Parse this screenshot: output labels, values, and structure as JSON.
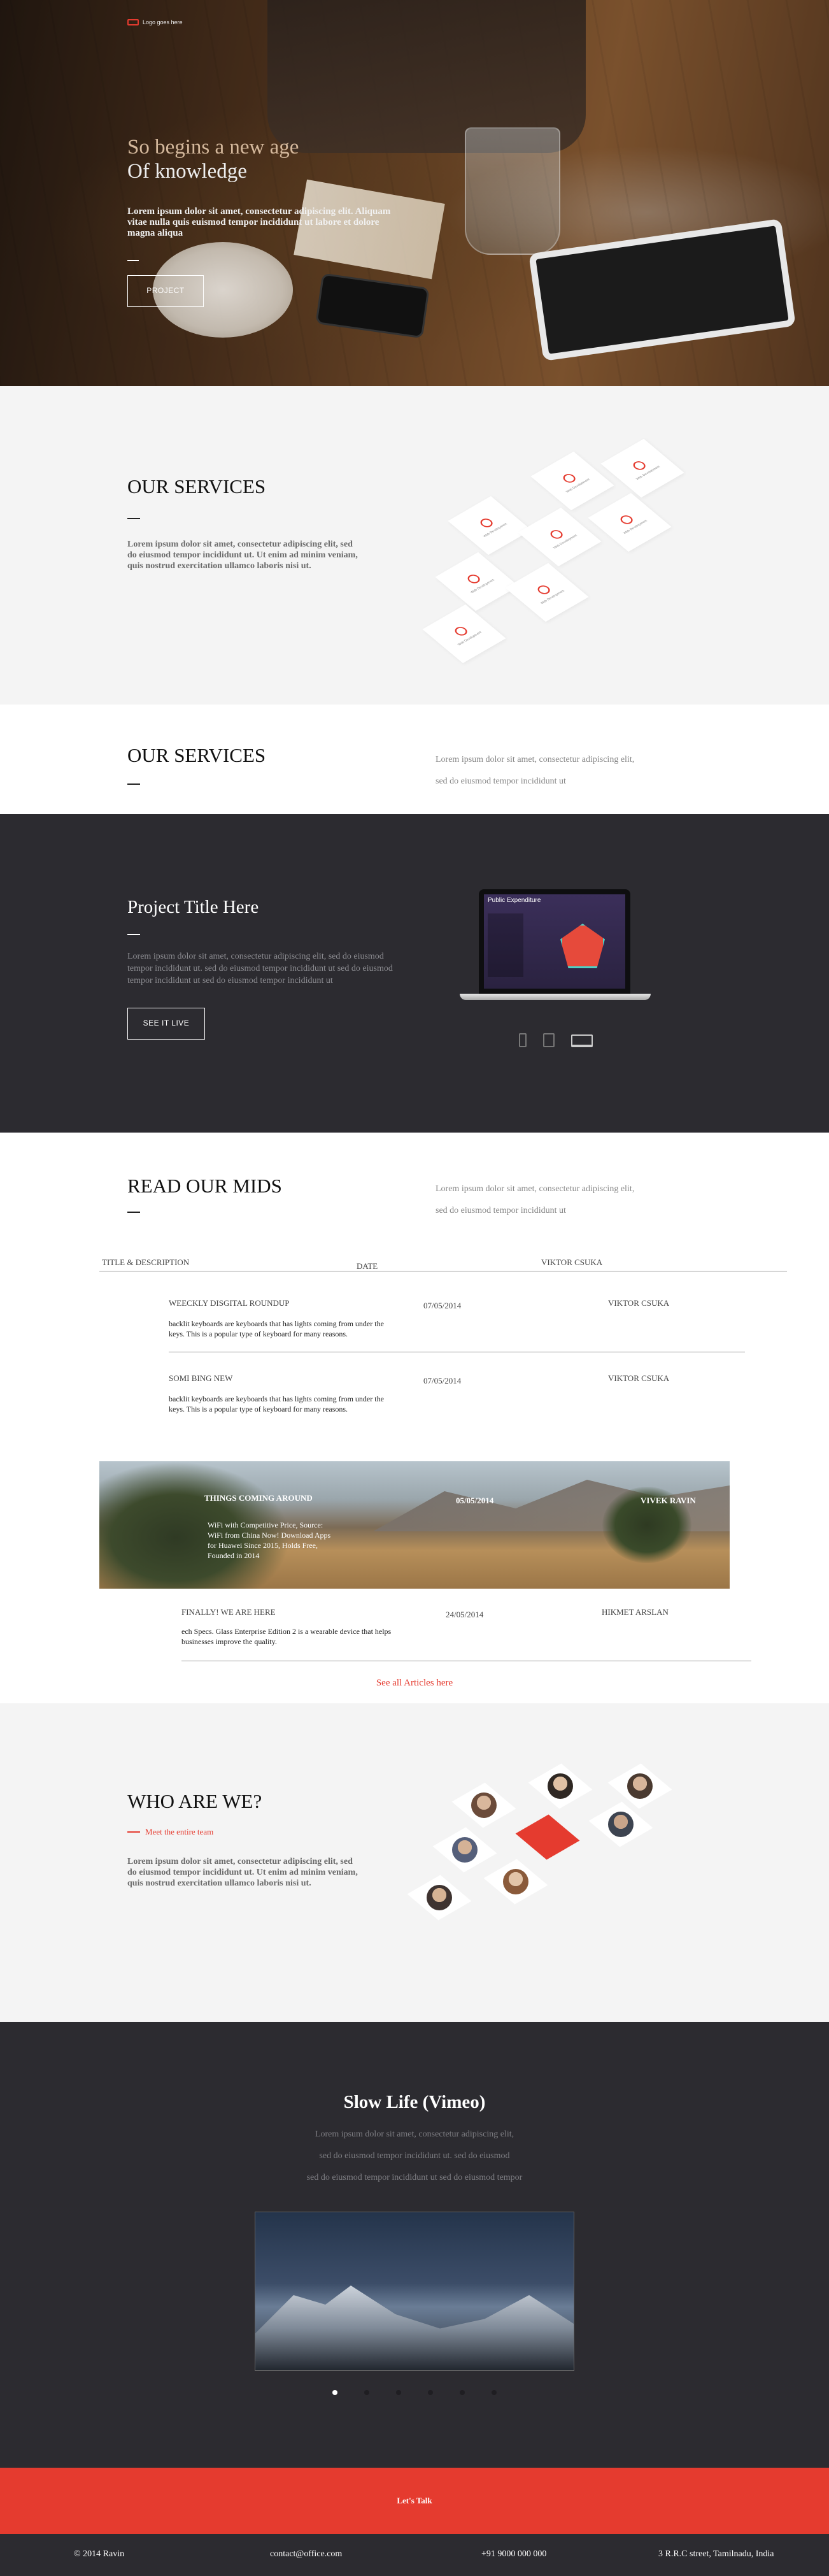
{
  "hero": {
    "logo_text": "Logo goes here",
    "title_line1": "So begins a new age",
    "title_line2": "Of knowledge",
    "lead": "Lorem ipsum dolor sit amet, consectetur adipiscing elit. Aliquam vitae nulla quis euismod tempor incididunt ut labore et dolore magna aliqua",
    "button": "PROJECT"
  },
  "services1": {
    "title": "OUR SERVICES",
    "body": "Lorem ipsum dolor sit amet, consectetur adipiscing elit, sed do eiusmod tempor incididunt ut. Ut enim ad minim veniam, quis nostrud exercitation ullamco laboris nisi ut.",
    "tiles": [
      {
        "label": "Web Development",
        "icon": "clock-icon"
      },
      {
        "label": "Web Development",
        "icon": "tools-icon"
      },
      {
        "label": "Web Development",
        "icon": "target-icon"
      },
      {
        "label": "Web Development",
        "icon": "gear-icon"
      },
      {
        "label": "Web Development",
        "icon": "cube-icon"
      },
      {
        "label": "Web Development",
        "icon": "pen-icon"
      },
      {
        "label": "Web Development",
        "icon": "location-icon"
      },
      {
        "label": "Web Development",
        "icon": "chart-icon"
      }
    ]
  },
  "services2": {
    "title": "OUR SERVICES",
    "copy_line1": "Lorem ipsum dolor sit amet, consectetur adipiscing elit,",
    "copy_line2": "sed do eiusmod tempor incididunt ut"
  },
  "project": {
    "title": "Project Title Here",
    "copy": "Lorem ipsum dolor sit amet, consectetur adipiscing elit, sed do eiusmod tempor incididunt ut. sed do eiusmod tempor incididunt ut sed do eiusmod tempor incididunt ut sed do eiusmod tempor incididunt ut",
    "button": "SEE IT LIVE",
    "screen_title": "Public Expenditure"
  },
  "mids": {
    "title": "READ OUR MIDS",
    "copy_line1": "Lorem ipsum dolor sit amet, consectetur adipiscing elit,",
    "copy_line2": "sed do eiusmod tempor incididunt ut",
    "headers": {
      "title": "TITLE & DESCRIPTION",
      "date": "DATE",
      "author": "VIKTOR CSUKA"
    },
    "rows": [
      {
        "title": "WEECKLY DISGITAL ROUNDUP",
        "date": "07/05/2014",
        "author": "VIKTOR CSUKA",
        "desc": "backlit keyboards are keyboards that has lights coming from under the keys. This is a popular type of keyboard for many reasons."
      },
      {
        "title": "SOMI BING NEW",
        "date": "07/05/2014",
        "author": "VIKTOR CSUKA",
        "desc": "backlit keyboards are keyboards that has lights coming from under the keys. This is a popular type of keyboard for many reasons."
      }
    ],
    "featured": {
      "title": "THINGS COMING AROUND",
      "date": "05/05/2014",
      "author": "VIVEK RAVIN",
      "desc": "WiFi with Competitive Price, Source: WiFi from China Now! Download Apps for Huawei Since 2015, Holds Free, Founded in 2014"
    },
    "last_row": {
      "title": "FINALLY! WE ARE HERE",
      "date": "24/05/2014",
      "author": "HIKMET ARSLAN",
      "desc": "ech Specs. Glass Enterprise Edition 2 is a wearable device that helps businesses improve the quality."
    },
    "see_all": "See all Articles here"
  },
  "who": {
    "title": "WHO ARE WE?",
    "meet_link": "Meet the entire team",
    "body": "Lorem ipsum dolor sit amet, consectetur adipiscing elit, sed do eiusmod tempor incididunt ut. Ut enim ad minim veniam, quis nostrud exercitation ullamco laboris nisi ut."
  },
  "slow": {
    "title": "Slow Life (Vimeo)",
    "copy_line1": "Lorem ipsum dolor sit amet, consectetur adipiscing elit,",
    "copy_line2": "sed do eiusmod tempor incididunt ut. sed do eiusmod",
    "copy_line3": "sed do eiusmod tempor incididunt ut sed do eiusmod tempor",
    "slides": 6,
    "active_slide": 1
  },
  "cta": {
    "label": "Let's Talk"
  },
  "footer": {
    "copyright": "© 2014 Ravin",
    "email": "contact@office.com",
    "phone": "+91 9000 000 000",
    "address": "3 R.R.C street, Tamilnadu, India"
  },
  "colors": {
    "accent": "#e53b2f",
    "dark": "#2c2b30",
    "light": "#f4f4f4"
  }
}
